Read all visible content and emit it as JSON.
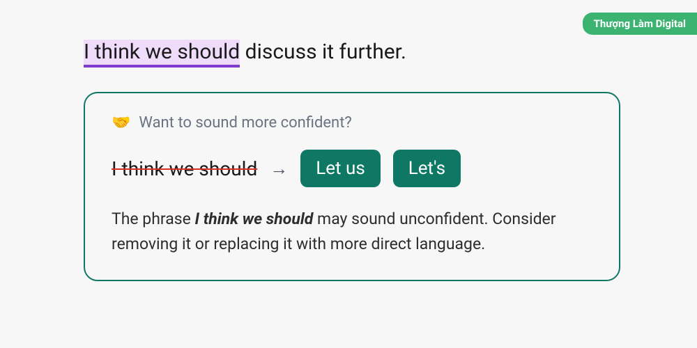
{
  "attribution": "Thượng Làm Digital",
  "sentence": {
    "highlighted": "I think we should",
    "rest": " discuss it further."
  },
  "card": {
    "emoji": "🤝",
    "title": "Want to sound more confident?",
    "strike_text": "I think we should",
    "arrow": "→",
    "options": [
      "Let us",
      "Let's"
    ],
    "explanation_pre": "The phrase ",
    "explanation_bold": "I think we should",
    "explanation_post": " may sound unconfident. Consider removing it or replacing it with more direct language."
  }
}
